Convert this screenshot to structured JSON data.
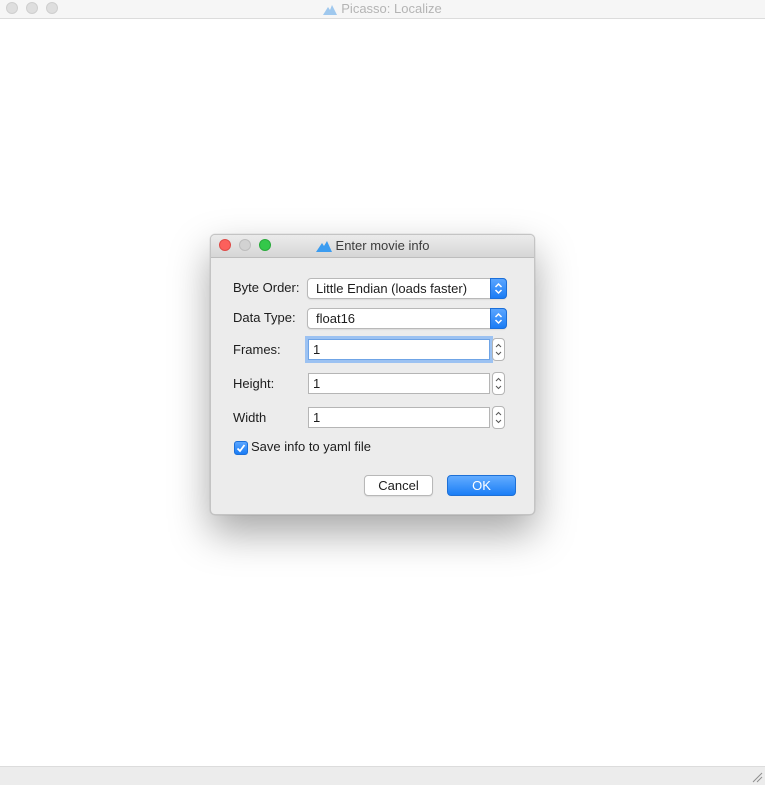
{
  "main_window": {
    "title": "Picasso: Localize"
  },
  "dialog": {
    "title": "Enter movie info",
    "byte_order": {
      "label": "Byte Order:",
      "value": "Little Endian (loads faster)"
    },
    "data_type": {
      "label": "Data Type:",
      "value": "float16"
    },
    "frames": {
      "label": "Frames:",
      "value": "1"
    },
    "height": {
      "label": "Height:",
      "value": "1"
    },
    "width": {
      "label": "Width",
      "value": "1"
    },
    "save_yaml": {
      "label": "Save info to yaml file",
      "checked": true
    },
    "cancel_label": "Cancel",
    "ok_label": "OK"
  },
  "colors": {
    "accent": "#1a7cf5",
    "close": "#fc605c",
    "maximize": "#34c84a",
    "app_icon": "#3b9cf0"
  },
  "icons": {
    "app": "mountain-icon"
  }
}
